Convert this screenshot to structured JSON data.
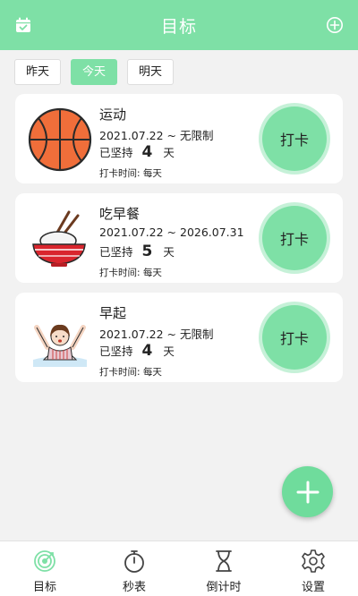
{
  "header": {
    "title": "目标"
  },
  "day_tabs": [
    {
      "label": "昨天",
      "active": false
    },
    {
      "label": "今天",
      "active": true
    },
    {
      "label": "明天",
      "active": false
    }
  ],
  "goals": [
    {
      "name": "运动",
      "dates": "2021.07.22 ~ 无限制",
      "streak_prefix": "已坚持",
      "streak_days": "4",
      "streak_unit": "天",
      "checkin_time": "打卡时间:   每天",
      "button": "打卡",
      "icon": "basketball-icon"
    },
    {
      "name": "吃早餐",
      "dates": "2021.07.22 ~ 2026.07.31",
      "streak_prefix": "已坚持",
      "streak_days": "5",
      "streak_unit": "天",
      "checkin_time": "打卡时间:   每天",
      "button": "打卡",
      "icon": "rice-bowl-icon"
    },
    {
      "name": "早起",
      "dates": "2021.07.22 ~ 无限制",
      "streak_prefix": "已坚持",
      "streak_days": "4",
      "streak_unit": "天",
      "checkin_time": "打卡时间:   每天",
      "button": "打卡",
      "icon": "wake-up-person-icon"
    }
  ],
  "bottom_nav": [
    {
      "label": "目标",
      "icon": "target-icon",
      "active": true
    },
    {
      "label": "秒表",
      "icon": "stopwatch-icon",
      "active": false
    },
    {
      "label": "倒计时",
      "icon": "hourglass-icon",
      "active": false
    },
    {
      "label": "设置",
      "icon": "gear-icon",
      "active": false
    }
  ],
  "colors": {
    "accent": "#7ee0a6",
    "accent_ring": "#c6f1d8",
    "background": "#f2f2f2"
  }
}
